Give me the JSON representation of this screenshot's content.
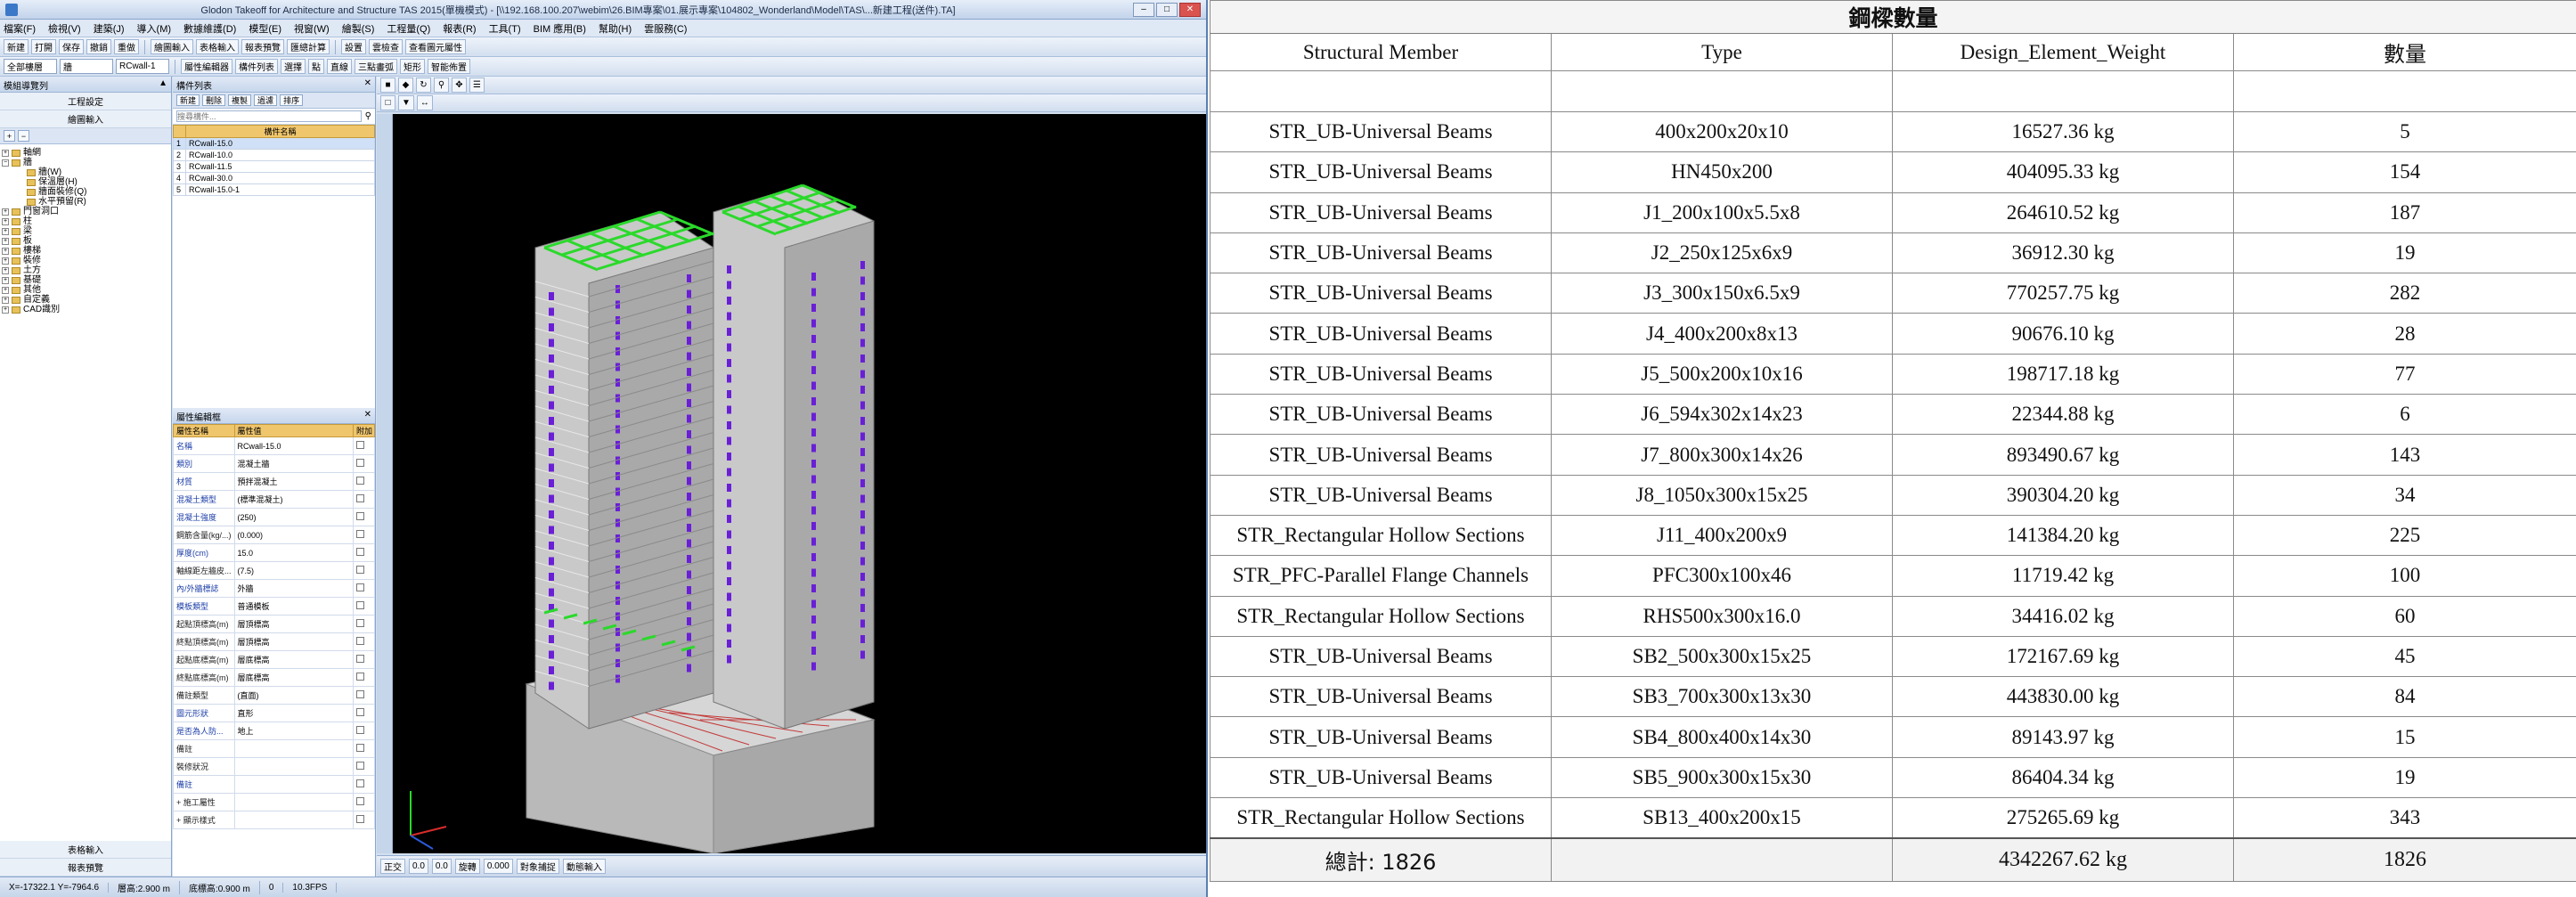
{
  "app": {
    "title": "Glodon Takeoff for Architecture and Structure TAS 2015(單機模式) - [\\\\192.168.100.207\\webim\\26.BIM專案\\01.展示專案\\104802_Wonderland\\Model\\TAS\\...新建工程(送件).TA]",
    "menu": [
      "檔案(F)",
      "檢視(V)",
      "建築(J)",
      "導入(M)",
      "數據維護(D)",
      "模型(E)",
      "視窗(W)",
      "繪製(S)",
      "工程量(Q)",
      "報表(R)",
      "工具(T)",
      "BIM 應用(B)",
      "幫助(H)",
      "雲服務(C)"
    ],
    "toolbar1": [
      "新建",
      "打開",
      "保存",
      "撤銷",
      "重做",
      "繪圖輸入",
      "表格輸入",
      "報表預覽",
      "匯總計算",
      "設置",
      "雲檢查",
      "查看圖元屬性"
    ],
    "toolbar2": {
      "floor_select": "全部樓層",
      "component_select": "牆",
      "type_select": "RCwall-1",
      "buttons": [
        "屬性編輯器",
        "構件列表",
        "選擇",
        "點",
        "直線",
        "三點畫弧",
        "矩形",
        "智能佈置"
      ]
    },
    "left_panel": {
      "header": "模組導覽列",
      "btn_top1": "工程設定",
      "btn_top2": "繪圖輸入",
      "tree": [
        {
          "label": "軸網",
          "level": 0,
          "expanded": false
        },
        {
          "label": "牆",
          "level": 0,
          "expanded": true
        },
        {
          "label": "牆(W)",
          "level": 1
        },
        {
          "label": "保溫層(H)",
          "level": 1
        },
        {
          "label": "牆面裝修(Q)",
          "level": 1
        },
        {
          "label": "水平預留(R)",
          "level": 1
        },
        {
          "label": "門窗洞口",
          "level": 0,
          "expanded": false
        },
        {
          "label": "柱",
          "level": 0,
          "expanded": false
        },
        {
          "label": "梁",
          "level": 0,
          "expanded": false
        },
        {
          "label": "板",
          "level": 0,
          "expanded": false
        },
        {
          "label": "樓梯",
          "level": 0,
          "expanded": false
        },
        {
          "label": "裝修",
          "level": 0,
          "expanded": false
        },
        {
          "label": "土方",
          "level": 0,
          "expanded": false
        },
        {
          "label": "基礎",
          "level": 0,
          "expanded": false
        },
        {
          "label": "其他",
          "level": 0,
          "expanded": false
        },
        {
          "label": "自定義",
          "level": 0,
          "expanded": false
        },
        {
          "label": "CAD識別",
          "level": 0,
          "expanded": false
        }
      ],
      "btn_bottom1": "表格輸入",
      "btn_bottom2": "報表預覽"
    },
    "component_list": {
      "header": "構件列表",
      "search_placeholder": "搜尋構件...",
      "toolbar": [
        "新建",
        "刪除",
        "複製",
        "過濾",
        "排序"
      ],
      "column_header": "構件名稱",
      "rows": [
        {
          "no": "1",
          "name": "RCwall-15.0"
        },
        {
          "no": "2",
          "name": "RCwall-10.0"
        },
        {
          "no": "3",
          "name": "RCwall-11.5"
        },
        {
          "no": "4",
          "name": "RCwall-30.0"
        },
        {
          "no": "5",
          "name": "RCwall-15.0-1"
        }
      ]
    },
    "property_editor": {
      "header": "屬性編輯框",
      "col_name": "屬性名稱",
      "col_value": "屬性值",
      "col_attach": "附加",
      "rows": [
        {
          "name": "名稱",
          "value": "RCwall-15.0",
          "blue": true
        },
        {
          "name": "類別",
          "value": "混凝土牆",
          "blue": true
        },
        {
          "name": "材質",
          "value": "預拌混凝土",
          "blue": true
        },
        {
          "name": "混凝土類型",
          "value": "(標準混凝土)",
          "blue": true
        },
        {
          "name": "混凝土強度",
          "value": "(250)",
          "blue": true
        },
        {
          "name": "鋼筋含量(kg/...)",
          "value": "(0.000)",
          "blue": false
        },
        {
          "name": "厚度(cm)",
          "value": "15.0",
          "blue": true
        },
        {
          "name": "軸線距左牆皮...",
          "value": "(7.5)",
          "blue": false
        },
        {
          "name": "內/外牆標誌",
          "value": "外牆",
          "blue": true
        },
        {
          "name": "模板類型",
          "value": "普通模板",
          "blue": true
        },
        {
          "name": "起點頂標高(m)",
          "value": "層頂標高",
          "blue": false
        },
        {
          "name": "終點頂標高(m)",
          "value": "層頂標高",
          "blue": false
        },
        {
          "name": "起點底標高(m)",
          "value": "層底標高",
          "blue": false
        },
        {
          "name": "終點底標高(m)",
          "value": "層底標高",
          "blue": false
        },
        {
          "name": "備註類型",
          "value": "(直面)",
          "blue": false
        },
        {
          "name": "圖元形狀",
          "value": "直形",
          "blue": true
        },
        {
          "name": "是否為人防...",
          "value": "地上",
          "blue": true
        },
        {
          "name": "備註",
          "value": "",
          "blue": false
        },
        {
          "name": "裝修狀況",
          "value": "",
          "blue": false
        },
        {
          "name": "備註",
          "value": "",
          "blue": true
        },
        {
          "name": "+ 施工屬性",
          "value": "",
          "blue": false
        },
        {
          "name": "+ 顯示樣式",
          "value": "",
          "blue": false
        }
      ]
    },
    "viewport_bottom": [
      "正交",
      "0.0",
      "0.0",
      "旋轉",
      "0.000",
      "對象捕捉",
      "動態輸入"
    ],
    "status": [
      "X=-17322.1 Y=-7964.6",
      "層高:2.900 m",
      "底標高:0.900 m",
      "0",
      "10.3FPS"
    ]
  },
  "steel_table": {
    "title": "鋼樑數量",
    "headers": [
      "Structural Member",
      "Type",
      "Design_Element_Weight",
      "數量"
    ],
    "rows": [
      [
        "STR_UB-Universal Beams",
        "400x200x20x10",
        "16527.36 kg",
        "5"
      ],
      [
        "STR_UB-Universal Beams",
        "HN450x200",
        "404095.33 kg",
        "154"
      ],
      [
        "STR_UB-Universal Beams",
        "J1_200x100x5.5x8",
        "264610.52 kg",
        "187"
      ],
      [
        "STR_UB-Universal Beams",
        "J2_250x125x6x9",
        "36912.30 kg",
        "19"
      ],
      [
        "STR_UB-Universal Beams",
        "J3_300x150x6.5x9",
        "770257.75 kg",
        "282"
      ],
      [
        "STR_UB-Universal Beams",
        "J4_400x200x8x13",
        "90676.10 kg",
        "28"
      ],
      [
        "STR_UB-Universal Beams",
        "J5_500x200x10x16",
        "198717.18 kg",
        "77"
      ],
      [
        "STR_UB-Universal Beams",
        "J6_594x302x14x23",
        "22344.88 kg",
        "6"
      ],
      [
        "STR_UB-Universal Beams",
        "J7_800x300x14x26",
        "893490.67 kg",
        "143"
      ],
      [
        "STR_UB-Universal Beams",
        "J8_1050x300x15x25",
        "390304.20 kg",
        "34"
      ],
      [
        "STR_Rectangular Hollow Sections",
        "J11_400x200x9",
        "141384.20 kg",
        "225"
      ],
      [
        "STR_PFC-Parallel Flange Channels",
        "PFC300x100x46",
        "11719.42 kg",
        "100"
      ],
      [
        "STR_Rectangular Hollow Sections",
        "RHS500x300x16.0",
        "34416.02 kg",
        "60"
      ],
      [
        "STR_UB-Universal Beams",
        "SB2_500x300x15x25",
        "172167.69 kg",
        "45"
      ],
      [
        "STR_UB-Universal Beams",
        "SB3_700x300x13x30",
        "443830.00 kg",
        "84"
      ],
      [
        "STR_UB-Universal Beams",
        "SB4_800x400x14x30",
        "89143.97 kg",
        "15"
      ],
      [
        "STR_UB-Universal Beams",
        "SB5_900x300x15x30",
        "86404.34 kg",
        "19"
      ],
      [
        "STR_Rectangular Hollow Sections",
        "SB13_400x200x15",
        "275265.69 kg",
        "343"
      ]
    ],
    "total_label": "總計: 1826",
    "total_weight": "4342267.62 kg",
    "total_count": "1826"
  },
  "colors": {
    "steel_beam": "#2bd92b",
    "window": "#6a1fd6",
    "concrete": "#c9c9c9",
    "viewport_bg": "#000000"
  }
}
